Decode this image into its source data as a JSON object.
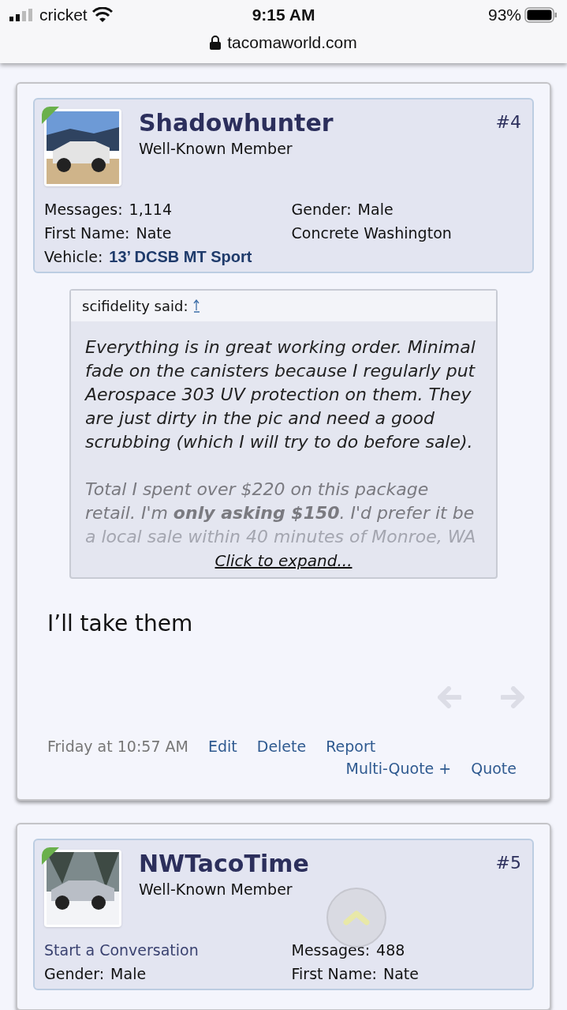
{
  "status_bar": {
    "carrier": "cricket",
    "time": "9:15 AM",
    "battery": "93%"
  },
  "address_bar": {
    "url": "tacomaworld.com"
  },
  "posts": [
    {
      "author": "Shadowhunter",
      "title": "Well-Known Member",
      "number": "#4",
      "avatar": {
        "kind": "picture"
      },
      "online": true,
      "fields": [
        {
          "kind": "pair",
          "label": "Messages:",
          "value": "1,114"
        },
        {
          "kind": "pair",
          "label": "Gender:",
          "value": "Male"
        },
        {
          "kind": "pair",
          "label": "First Name:",
          "value": "Nate"
        },
        {
          "kind": "plain",
          "value": "Concrete Washington"
        },
        {
          "kind": "vehicle",
          "label": "Vehicle:",
          "value": "13’ DCSB MT Sport"
        }
      ],
      "quote": {
        "author": "scifidelity said:",
        "paragraphs": [
          {
            "text": "Everything is in great working order. Minimal fade on the canisters because I regularly put Aerospace 303 UV protection on them. They are just dirty in the pic and need a good scrubbing (which I will try to do before sale).",
            "kind": "body"
          },
          {
            "text": "Total I spent over $220 on this package retail. I'm **only asking $150**. I'd prefer it be",
            "kind": "faded"
          },
          {
            "text": "a local sale within 40 minutes of Monroe, WA",
            "kind": "faint"
          }
        ],
        "expand": "Click to expand..."
      },
      "message": "I’ll take them",
      "date": "Friday at 10:57 AM",
      "actions": [
        "Edit",
        "Delete",
        "Report"
      ],
      "actions2": [
        "Multi-Quote +",
        "Quote"
      ]
    },
    {
      "author": "NWTacoTime",
      "title": "Well-Known Member",
      "number": "#5",
      "avatar": {
        "kind": "picture"
      },
      "online": true,
      "fields": [
        {
          "kind": "link",
          "value": "Start a Conversation"
        },
        {
          "kind": "pair",
          "label": "Messages:",
          "value": "488"
        },
        {
          "kind": "pair",
          "label": "Gender:",
          "value": "Male"
        },
        {
          "kind": "pair",
          "label": "First Name:",
          "value": "Nate"
        }
      ]
    }
  ]
}
